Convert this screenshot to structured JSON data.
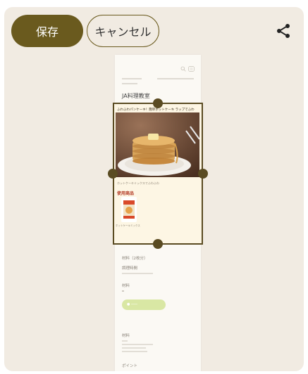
{
  "toolbar": {
    "save_label": "保存",
    "cancel_label": "キャンセル",
    "share_icon": "share-icon"
  },
  "colors": {
    "primary": "#6a5a1e",
    "crop_frame": "#5a4b22",
    "background": "#f1ebe2",
    "product_heading": "#b33a25",
    "action_pill": "#d9e7a4"
  },
  "preview": {
    "page_title": "JA料理教室",
    "card_headline": "ふわふわパンケーキ！簡単ホットケーキ ラップでふわ",
    "card_caption": "ホットケーキミックスでふわふわ",
    "used_products_heading": "使用商品",
    "product_name": "ホットケーキミックス",
    "section_servings": "材料（2枚分）",
    "section_cook_time": "調理時間",
    "section_ingredients": "材料",
    "section_points": "ポイント"
  }
}
